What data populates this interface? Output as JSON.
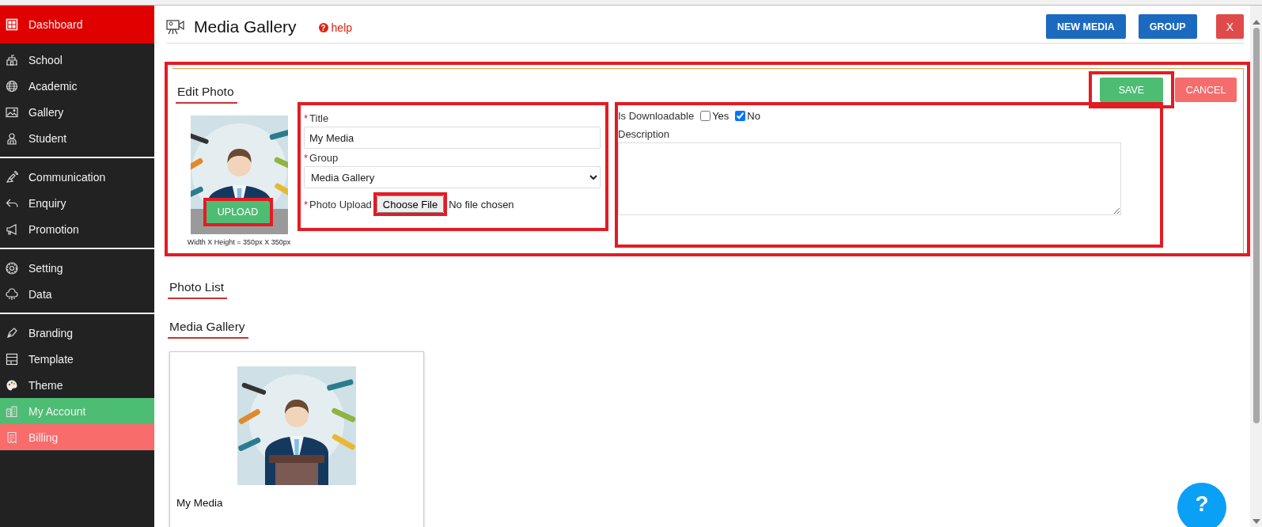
{
  "sidebar": {
    "groups": [
      {
        "divider_above": false,
        "items": [
          {
            "label": "Dashboard",
            "color": "#e00000"
          }
        ]
      },
      {
        "divider_above": false,
        "items": [
          {
            "label": "School"
          },
          {
            "label": "Academic"
          },
          {
            "label": "Gallery"
          },
          {
            "label": "Student"
          }
        ]
      },
      {
        "divider_above": true,
        "items": [
          {
            "label": "Communication"
          },
          {
            "label": "Enquiry"
          },
          {
            "label": "Promotion"
          }
        ]
      },
      {
        "divider_above": true,
        "items": [
          {
            "label": "Setting"
          },
          {
            "label": "Data"
          }
        ]
      },
      {
        "divider_above": true,
        "items": [
          {
            "label": "Branding"
          },
          {
            "label": "Template"
          },
          {
            "label": "Theme"
          },
          {
            "label": "My Account",
            "color": "#4dbd74"
          },
          {
            "label": "Billing",
            "color": "#f86c6b"
          }
        ]
      }
    ]
  },
  "header": {
    "title": "Media Gallery",
    "help_icon": "?",
    "help": "help",
    "buttons": [
      {
        "label": "NEW MEDIA",
        "kind": "primary"
      },
      {
        "label": "GROUP",
        "kind": "primary"
      },
      {
        "label": "X",
        "kind": "danger"
      }
    ]
  },
  "edit_panel": {
    "highlighted": true,
    "heading": "Edit Photo",
    "upload_button": {
      "label": "UPLOAD",
      "highlighted": true
    },
    "size_hint": "Width X Height = 350px X 350px",
    "form": {
      "highlighted": true,
      "title": {
        "mark": "*",
        "label": "Title",
        "value": "My Media"
      },
      "group": {
        "mark": "*",
        "label": "Group",
        "value": "Media Gallery"
      },
      "photo_upload": {
        "mark": "*",
        "label": "Photo Upload",
        "button": "Choose File",
        "button_highlighted": true,
        "status": "No file chosen"
      }
    },
    "options": {
      "highlighted": true,
      "downloadable_label": "Is Downloadable",
      "choices": [
        {
          "label": "Yes",
          "checked": false
        },
        {
          "label": "No",
          "checked": true
        }
      ],
      "description_label": "Description"
    },
    "save_button": {
      "label": "SAVE",
      "highlighted": true
    },
    "cancel_button": {
      "label": "CANCEL",
      "highlighted": false
    }
  },
  "photo_list": {
    "heading": "Photo List",
    "group_heading": "Media Gallery",
    "items": [
      {
        "title": "My Media"
      }
    ]
  },
  "help_fab": {
    "label": "?"
  }
}
